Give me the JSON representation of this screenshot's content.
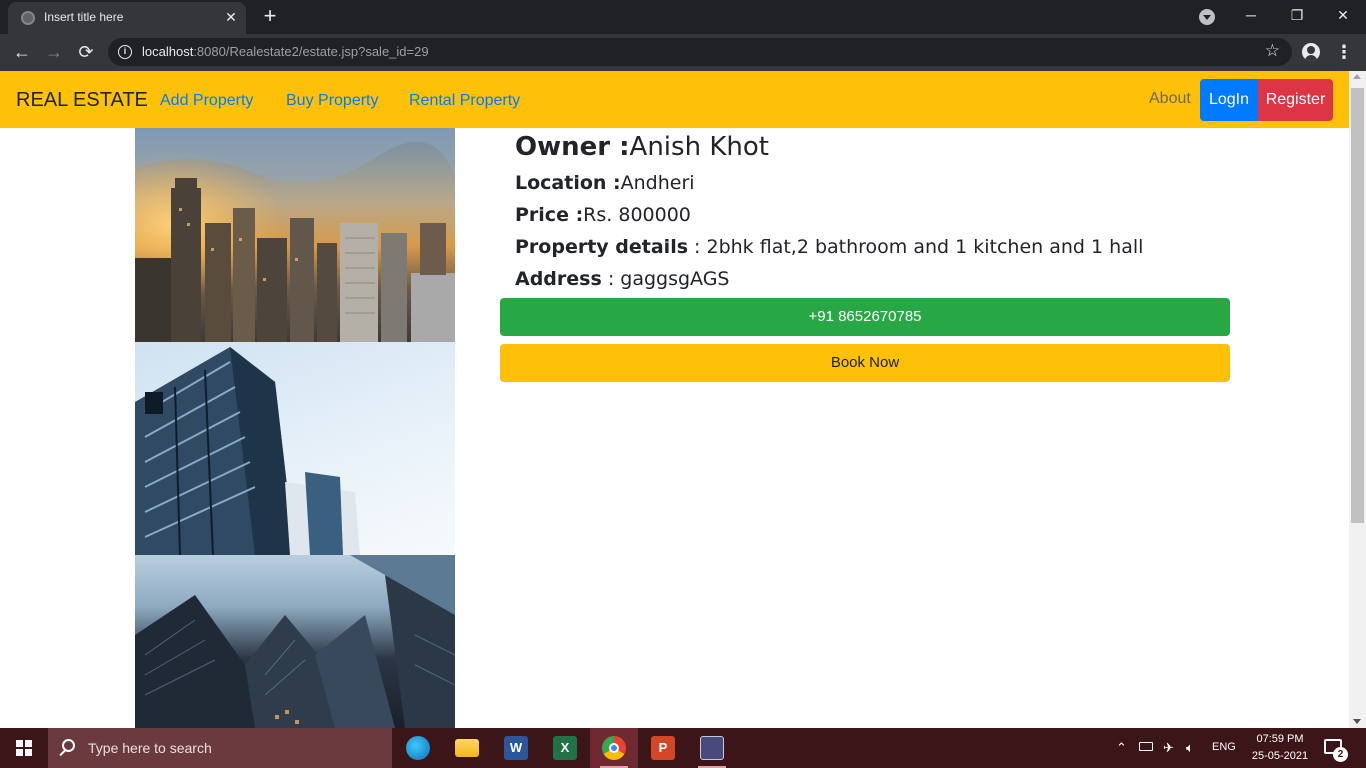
{
  "browser": {
    "tab_title": "Insert title here",
    "tab_close": "✕",
    "new_tab": "+",
    "url_host": "localhost",
    "url_rest": ":8080/Realestate2/estate.jsp?sale_id=29",
    "window_minimize": "─",
    "window_restore": "❐",
    "window_close": "✕"
  },
  "navbar": {
    "brand": "REAL ESTATE",
    "links": [
      "Add Property",
      "Buy Property",
      "Rental Property"
    ],
    "about": "About",
    "login": "LogIn",
    "register": "Register"
  },
  "property": {
    "owner_label": "Owner :",
    "owner_value": "Anish Khot",
    "location_label": "Location :",
    "location_value": "Andheri",
    "price_label": "Price :",
    "price_value": "Rs. 800000",
    "details_label": "Property details",
    "details_value": " : 2bhk flat,2 bathroom and 1 kitchen and 1 hall",
    "address_label": "Address",
    "address_value": " : gaggsgAGS",
    "phone_button": "+91 8652670785",
    "book_button": "Book Now"
  },
  "taskbar": {
    "search_placeholder": "Type here to search",
    "apps": [
      "edge",
      "file-explorer",
      "word",
      "excel",
      "chrome",
      "powerpoint",
      "app"
    ],
    "language": "ENG",
    "time": "07:59 PM",
    "date": "25-05-2021",
    "notification_count": "2"
  },
  "colors": {
    "navbar_bg": "#ffc107",
    "login_bg": "#007bff",
    "register_bg": "#dc3545",
    "phone_bg": "#28a745",
    "book_bg": "#ffc107",
    "link": "#007bff"
  }
}
